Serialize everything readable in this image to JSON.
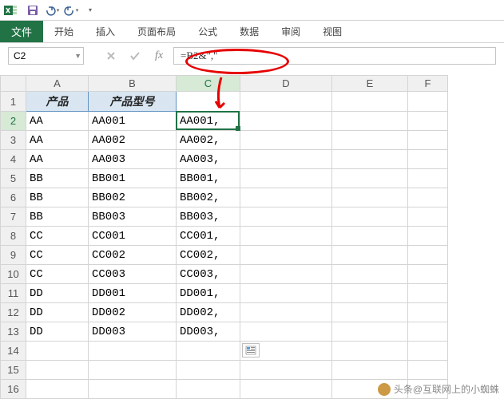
{
  "qat": {
    "save_tip": "保存",
    "undo_tip": "撤销",
    "redo_tip": "重做"
  },
  "ribbon": {
    "file": "文件",
    "tabs": [
      "开始",
      "插入",
      "页面布局",
      "公式",
      "数据",
      "审阅",
      "视图"
    ]
  },
  "namebox": "C2",
  "formula": "=B2&\",\"",
  "columns": [
    "A",
    "B",
    "C",
    "D",
    "E",
    "F"
  ],
  "header_row": {
    "A": "产品",
    "B": "产品型号"
  },
  "rows": [
    {
      "n": 1,
      "A": "产品",
      "B": "产品型号",
      "C": "",
      "hdr": true
    },
    {
      "n": 2,
      "A": "AA",
      "B": "AA001",
      "C": "AA001,"
    },
    {
      "n": 3,
      "A": "AA",
      "B": "AA002",
      "C": "AA002,"
    },
    {
      "n": 4,
      "A": "AA",
      "B": "AA003",
      "C": "AA003,"
    },
    {
      "n": 5,
      "A": "BB",
      "B": "BB001",
      "C": "BB001,"
    },
    {
      "n": 6,
      "A": "BB",
      "B": "BB002",
      "C": "BB002,"
    },
    {
      "n": 7,
      "A": "BB",
      "B": "BB003",
      "C": "BB003,"
    },
    {
      "n": 8,
      "A": "CC",
      "B": "CC001",
      "C": "CC001,"
    },
    {
      "n": 9,
      "A": "CC",
      "B": "CC002",
      "C": "CC002,"
    },
    {
      "n": 10,
      "A": "CC",
      "B": "CC003",
      "C": "CC003,"
    },
    {
      "n": 11,
      "A": "DD",
      "B": "DD001",
      "C": "DD001,"
    },
    {
      "n": 12,
      "A": "DD",
      "B": "DD002",
      "C": "DD002,"
    },
    {
      "n": 13,
      "A": "DD",
      "B": "DD003",
      "C": "DD003,"
    },
    {
      "n": 14,
      "A": "",
      "B": "",
      "C": ""
    },
    {
      "n": 15,
      "A": "",
      "B": "",
      "C": ""
    },
    {
      "n": 16,
      "A": "",
      "B": "",
      "C": ""
    }
  ],
  "selected": {
    "row": 2,
    "col": "C"
  },
  "attribution": "头条@互联网上的小蜘蛛"
}
